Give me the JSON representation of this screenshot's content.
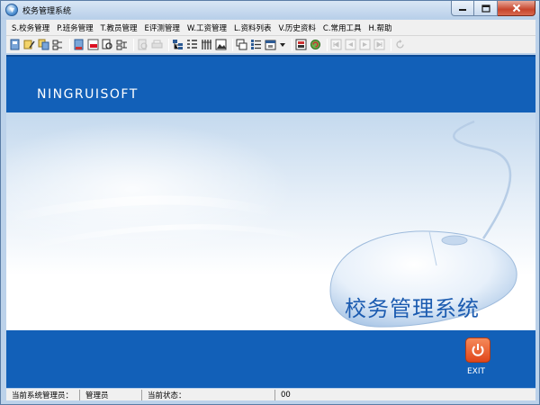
{
  "window": {
    "title": "校务管理系统",
    "controls": [
      "minimize",
      "maximize",
      "close"
    ]
  },
  "menubar": {
    "items": [
      {
        "label": "S.校务管理"
      },
      {
        "label": "P.班务管理"
      },
      {
        "label": "T.教员管理"
      },
      {
        "label": "E评测管理"
      },
      {
        "label": "W.工资管理"
      },
      {
        "label": "L.资料列表"
      },
      {
        "label": "V.历史资料"
      },
      {
        "label": "C.常用工具"
      },
      {
        "label": "H.帮助"
      }
    ]
  },
  "toolbar": {
    "buttons": [
      "new-record-icon",
      "edit-icon",
      "copy-icon",
      "delete-icon",
      "print-icon",
      "export-icon",
      "find-icon",
      "filter-icon",
      "print-preview-icon",
      "printer-icon",
      "tree-icon",
      "list-icon",
      "columns-icon",
      "picture-icon",
      "window-icon",
      "detail-list-icon",
      "calendar-icon",
      "dropdown-icon",
      "calculator-icon",
      "recycle-icon",
      "first-icon",
      "prev-icon",
      "next-icon",
      "last-icon",
      "refresh-icon"
    ]
  },
  "main": {
    "brand": "NINGRUISOFT",
    "system_title": "校务管理系统",
    "exit_label": "EXIT"
  },
  "colors": {
    "band_blue": "#1260b8",
    "title_blue": "#1b5bb0",
    "exit_orange": "#e0461a"
  },
  "statusbar": {
    "admin_label": "当前系统管理员：",
    "admin_value": "管理员",
    "state_label": "当前状态：",
    "state_value": "",
    "code_value": "00"
  }
}
